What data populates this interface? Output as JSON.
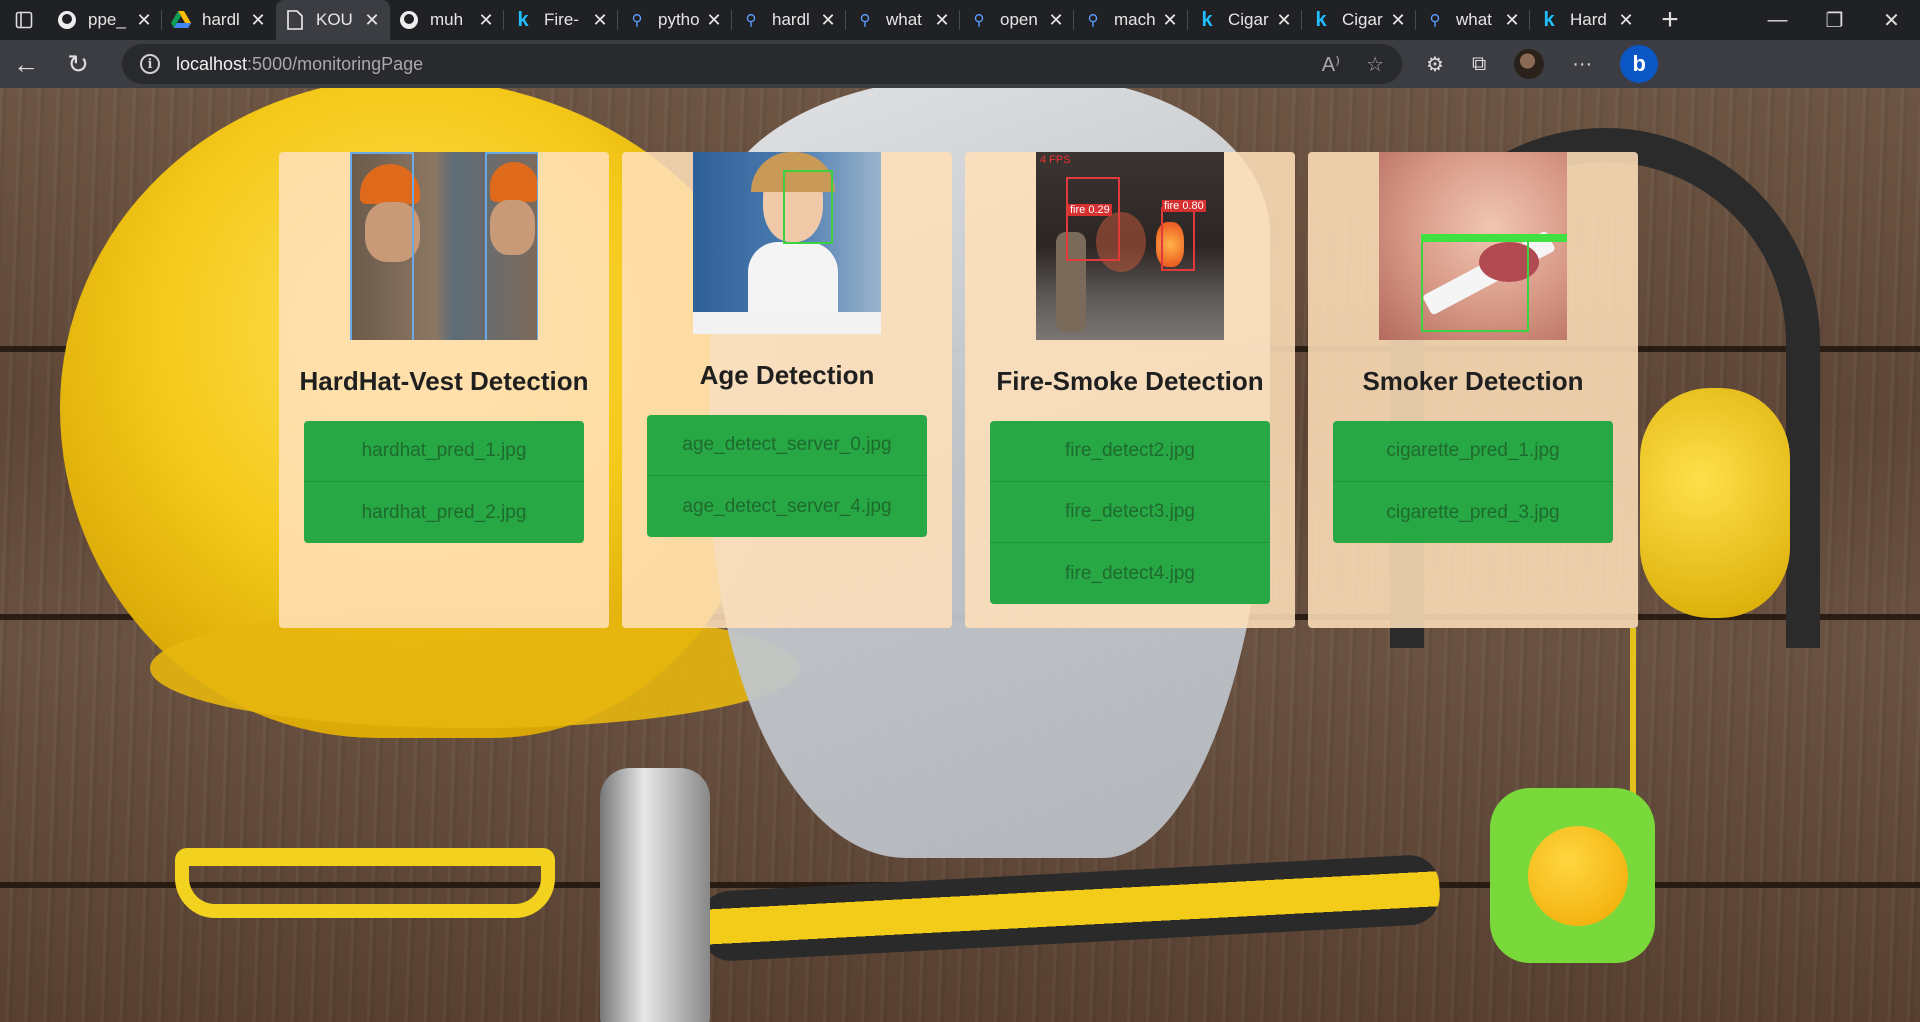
{
  "browser": {
    "tabs": [
      {
        "label": "ppe_",
        "icon": "github-icon",
        "active": false
      },
      {
        "label": "hardl",
        "icon": "google-drive-icon",
        "active": false
      },
      {
        "label": "KOU",
        "icon": "page-icon",
        "active": true
      },
      {
        "label": "muh",
        "icon": "github-icon",
        "active": false
      },
      {
        "label": "Fire-",
        "icon": "kaggle-icon",
        "active": false
      },
      {
        "label": "pytho",
        "icon": "search-icon",
        "active": false
      },
      {
        "label": "hardl",
        "icon": "search-icon",
        "active": false
      },
      {
        "label": "what",
        "icon": "search-icon",
        "active": false
      },
      {
        "label": "open",
        "icon": "search-icon",
        "active": false
      },
      {
        "label": "mach",
        "icon": "search-icon",
        "active": false
      },
      {
        "label": "Cigar",
        "icon": "kaggle-icon",
        "active": false
      },
      {
        "label": "Cigar",
        "icon": "kaggle-icon",
        "active": false
      },
      {
        "label": "what",
        "icon": "search-icon",
        "active": false
      },
      {
        "label": "Hard",
        "icon": "kaggle-icon",
        "active": false
      }
    ],
    "url_host": "localhost",
    "url_path": ":5000/monitoringPage"
  },
  "cards": [
    {
      "title": "HardHat-Vest Detection",
      "files": [
        "hardhat_pred_1.jpg",
        "hardhat_pred_2.jpg"
      ]
    },
    {
      "title": "Age Detection",
      "files": [
        "age_detect_server_0.jpg",
        "age_detect_server_4.jpg"
      ]
    },
    {
      "title": "Fire-Smoke Detection",
      "files": [
        "fire_detect2.jpg",
        "fire_detect3.jpg",
        "fire_detect4.jpg"
      ]
    },
    {
      "title": "Smoker Detection",
      "files": [
        "cigarette_pred_1.jpg",
        "cigarette_pred_3.jpg"
      ]
    }
  ],
  "thumb_labels": {
    "fire_1": "fire 0.29",
    "fire_2": "fire 0.80",
    "fire_fps": "4 FPS"
  },
  "colors": {
    "card_bg": "#ffe0ba",
    "file_button": "#28a745",
    "page_background": "wood-texture"
  }
}
